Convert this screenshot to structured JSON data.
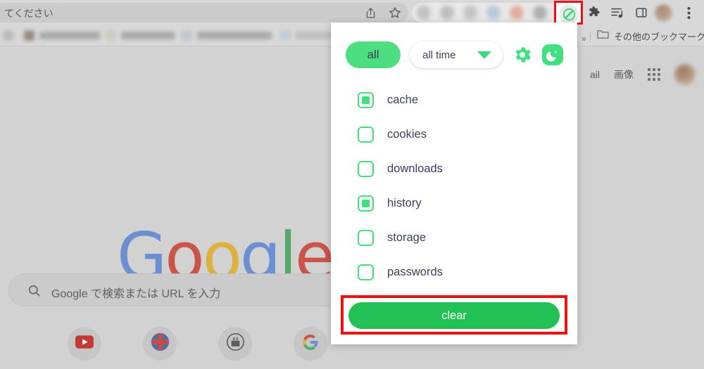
{
  "browser": {
    "omnibox_text": "てください",
    "share_icon": "share-icon",
    "bookmark_star_icon": "star-icon",
    "extension_icon": "eraser-slash-icon",
    "puzzle_icon": "puzzle-piece-icon",
    "media_icon": "media-list-icon",
    "sidepanel_icon": "side-panel-icon",
    "menu_icon": "three-dot-menu-icon",
    "bookmarks": {
      "overflow_label": "»",
      "other_bookmarks_label": "その他のブックマーク",
      "folder_icon": "folder-icon"
    }
  },
  "ntp": {
    "links": [
      {
        "label": "ail"
      },
      {
        "label": "画像"
      }
    ],
    "apps_icon": "apps-grid-icon",
    "avatar": "avatar",
    "logo": {
      "letters": [
        {
          "char": "G",
          "color": "#6b8fcf"
        },
        {
          "char": "o",
          "color": "#c9544a"
        },
        {
          "char": "o",
          "color": "#dcb23c"
        },
        {
          "char": "g",
          "color": "#6b8fcf"
        },
        {
          "char": "l",
          "color": "#55a868"
        },
        {
          "char": "e",
          "color": "#c9544a"
        }
      ]
    },
    "search": {
      "placeholder": "Google で検索または URL を入力",
      "icon": "search-icon"
    },
    "shortcuts": [
      {
        "name": "youtube-shortcut",
        "icon": "youtube-icon"
      },
      {
        "name": "flower-shortcut",
        "icon": "flower-icon"
      },
      {
        "name": "circle-shortcut",
        "icon": "circled-icon"
      },
      {
        "name": "google-shortcut",
        "icon": "google-g-icon"
      }
    ]
  },
  "popup": {
    "scope_pill": "all",
    "time_range": "all time",
    "settings_icon": "gear-icon",
    "night_icon": "moon-icon",
    "options": [
      {
        "label": "cache",
        "checked": true
      },
      {
        "label": "cookies",
        "checked": false
      },
      {
        "label": "downloads",
        "checked": false
      },
      {
        "label": "history",
        "checked": true
      },
      {
        "label": "storage",
        "checked": false
      },
      {
        "label": "passwords",
        "checked": false
      }
    ],
    "clear_button": "clear",
    "colors": {
      "pill_green": "#4ede82",
      "accent_green": "#3fe07e",
      "clear_green": "#22c055",
      "text_navy": "#3b4257",
      "highlight_red": "#ef1111"
    }
  }
}
